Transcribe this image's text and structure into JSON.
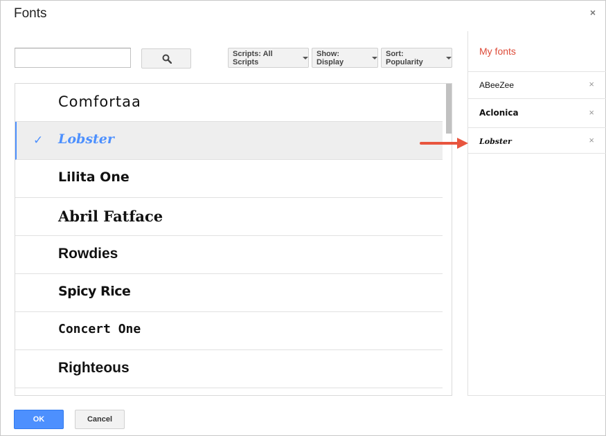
{
  "dialog": {
    "title": "Fonts"
  },
  "search": {
    "value": "",
    "placeholder": ""
  },
  "filters": {
    "scripts": "Scripts: All Scripts",
    "show": "Show: Display",
    "sort": "Sort: Popularity"
  },
  "font_list": [
    {
      "name": "Comfortaa",
      "selected": false,
      "style": "weight:normal; letter-spacing:1px; font-family:'DejaVu Sans', sans-serif;"
    },
    {
      "name": "Lobster",
      "selected": true,
      "check": "✓",
      "style": "font-style:italic; font-weight:bold; color:#4d90fe; font-family:'DejaVu Serif', serif; font-size:19px;"
    },
    {
      "name": "Lilita One",
      "selected": false,
      "style": "font-weight:bold; font-family:'DejaVu Sans', sans-serif;"
    },
    {
      "name": "Abril Fatface",
      "selected": false,
      "style": "font-weight:bold; font-family:'DejaVu Serif', serif;"
    },
    {
      "name": "Rowdies",
      "selected": false,
      "style": "font-weight:bold; font-family:'Liberation Sans', sans-serif;"
    },
    {
      "name": "Spicy Rice",
      "selected": false,
      "style": "font-weight:bold; font-family:'DejaVu Sans', sans-serif; letter-spacing:-0.5px;"
    },
    {
      "name": "Concert One",
      "selected": false,
      "style": "font-weight:bold; font-family:'DejaVu Sans Mono', monospace; font-size:19px;"
    },
    {
      "name": "Righteous",
      "selected": false,
      "style": "font-weight:bold; font-family:'Liberation Sans', sans-serif;"
    }
  ],
  "my_fonts": {
    "title": "My fonts",
    "items": [
      {
        "name": "ABeeZee",
        "remove": "×",
        "style": "font-family:'Liberation Sans', sans-serif;"
      },
      {
        "name": "Aclonica",
        "remove": "×",
        "style": "font-family:'DejaVu Sans', sans-serif; font-weight:bold;"
      },
      {
        "name": "Lobster",
        "remove": "×",
        "style": "font-family:'DejaVu Serif', serif; font-style:italic; font-weight:bold; font-size:11px;"
      }
    ]
  },
  "buttons": {
    "ok": "OK",
    "cancel": "Cancel",
    "close": "×"
  },
  "colors": {
    "accent": "#4d90fe",
    "my_fonts_title": "#dd4b39",
    "annotation_arrow": "#e8553e"
  }
}
